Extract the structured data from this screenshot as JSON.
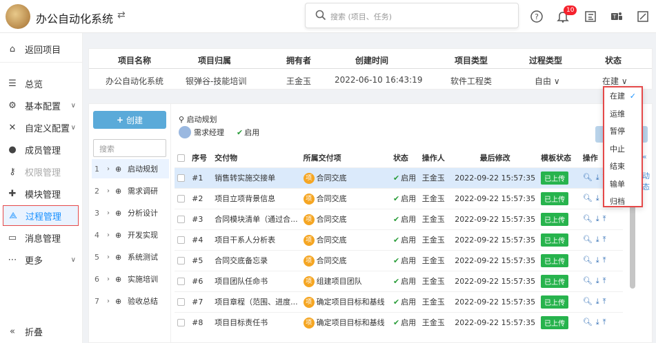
{
  "header": {
    "app_title": "办公自动化系统",
    "swap_symbol": "⇄",
    "search_placeholder": "搜索 (项目、任务)",
    "notification_count": "10",
    "icons": [
      "help-icon",
      "bell-icon",
      "layout-icon",
      "teams-icon",
      "expand-icon"
    ]
  },
  "sidebar": {
    "back": "返回项目",
    "items": [
      {
        "label": "总览",
        "icon": "overview-icon"
      },
      {
        "label": "基本配置",
        "icon": "gears-icon",
        "chevron": "∨"
      },
      {
        "label": "自定义配置",
        "icon": "tools-icon",
        "chevron": "∨"
      },
      {
        "label": "成员管理",
        "icon": "users-icon"
      },
      {
        "label": "权限管理",
        "icon": "key-icon"
      },
      {
        "label": "模块管理",
        "icon": "puzzle-icon"
      },
      {
        "label": "过程管理",
        "icon": "process-icon"
      },
      {
        "label": "消息管理",
        "icon": "message-icon"
      },
      {
        "label": "更多",
        "icon": "more-icon",
        "chevron": "∨"
      }
    ],
    "collapse": "折叠",
    "collapse_icon": "«"
  },
  "project_info": {
    "headers": [
      "项目名称",
      "项目归属",
      "拥有者",
      "创建时间",
      "项目类型",
      "过程类型",
      "状态"
    ],
    "values": [
      "办公自动化系统",
      "银弹谷-技能培训",
      "王金玉",
      "2022-06-10 16:43:19",
      "软件工程类",
      "自由 ∨",
      "在建 ∨"
    ]
  },
  "tree": {
    "create_label": "创建",
    "search_placeholder": "搜索",
    "items": [
      {
        "num": "1",
        "label": "启动规划"
      },
      {
        "num": "2",
        "label": "需求调研"
      },
      {
        "num": "3",
        "label": "分析设计"
      },
      {
        "num": "4",
        "label": "开发实现"
      },
      {
        "num": "5",
        "label": "系统测试"
      },
      {
        "num": "6",
        "label": "实施培训"
      },
      {
        "num": "7",
        "label": "验收总结"
      }
    ]
  },
  "detail": {
    "title": "启动规划",
    "owner": "需求经理",
    "status": "启用"
  },
  "table": {
    "headers": [
      "序号",
      "交付物",
      "所属交付项",
      "状态",
      "操作人",
      "最后修改",
      "模板状态",
      "操作"
    ],
    "rows": [
      {
        "no": "#1",
        "name": "销售转实施交接单",
        "item": "合同交底",
        "status": "启用",
        "user": "王金玉",
        "time": "2022-09-22 15:57:35",
        "tpl": "已上传"
      },
      {
        "no": "#2",
        "name": "项目立项背景信息",
        "item": "合同交底",
        "status": "启用",
        "user": "王金玉",
        "time": "2022-09-22 15:57:35",
        "tpl": "已上传"
      },
      {
        "no": "#3",
        "name": "合同模块清单（通过合...",
        "item": "合同交底",
        "status": "启用",
        "user": "王金玉",
        "time": "2022-09-22 15:57:35",
        "tpl": "已上传"
      },
      {
        "no": "#4",
        "name": "项目干系人分析表",
        "item": "合同交底",
        "status": "启用",
        "user": "王金玉",
        "time": "2022-09-22 15:57:35",
        "tpl": "已上传"
      },
      {
        "no": "#5",
        "name": "合同交底备忘录",
        "item": "合同交底",
        "status": "启用",
        "user": "王金玉",
        "time": "2022-09-22 15:57:35",
        "tpl": "已上传"
      },
      {
        "no": "#6",
        "name": "项目团队任命书",
        "item": "组建项目团队",
        "status": "启用",
        "user": "王金玉",
        "time": "2022-09-22 15:57:35",
        "tpl": "已上传"
      },
      {
        "no": "#7",
        "name": "项目章程（范围、进度...",
        "item": "确定项目目标和基线",
        "status": "启用",
        "user": "王金玉",
        "time": "2022-09-22 15:57:35",
        "tpl": "已上传"
      },
      {
        "no": "#8",
        "name": "项目目标责任书",
        "item": "确定项目目标和基线",
        "status": "启用",
        "user": "王金玉",
        "time": "2022-09-22 15:57:35",
        "tpl": "已上传"
      }
    ],
    "badge_char": "项"
  },
  "right_edge": {
    "a": "«",
    "b": "动",
    "c": "态"
  },
  "status_dropdown": {
    "options": [
      "在建",
      "运维",
      "暂停",
      "中止",
      "结束",
      "输单",
      "归档"
    ],
    "selected": "在建"
  }
}
